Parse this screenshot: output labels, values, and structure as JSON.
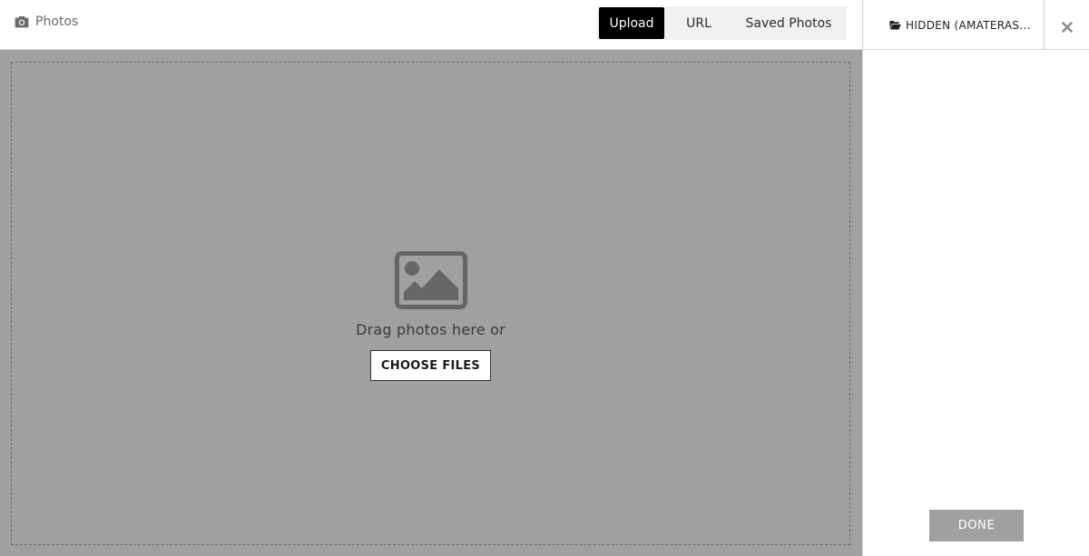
{
  "header": {
    "title": "Photos",
    "title_icon": "camera-icon"
  },
  "tabs": [
    {
      "label": "Upload",
      "active": true
    },
    {
      "label": "URL",
      "active": false
    },
    {
      "label": "Saved Photos",
      "active": false
    }
  ],
  "dropzone": {
    "icon": "image-icon",
    "prompt": "Drag photos here or",
    "button_label": "CHOOSE FILES"
  },
  "sidebar": {
    "folder_icon": "folder-open-icon",
    "folder_label": "HIDDEN (AMATERAS...",
    "close_icon": "close-icon",
    "done_label": "DONE"
  },
  "colors": {
    "active_tab_bg": "#000000",
    "dropzone_bg": "#a0a0a0",
    "done_button_bg": "#a0a0a0"
  }
}
